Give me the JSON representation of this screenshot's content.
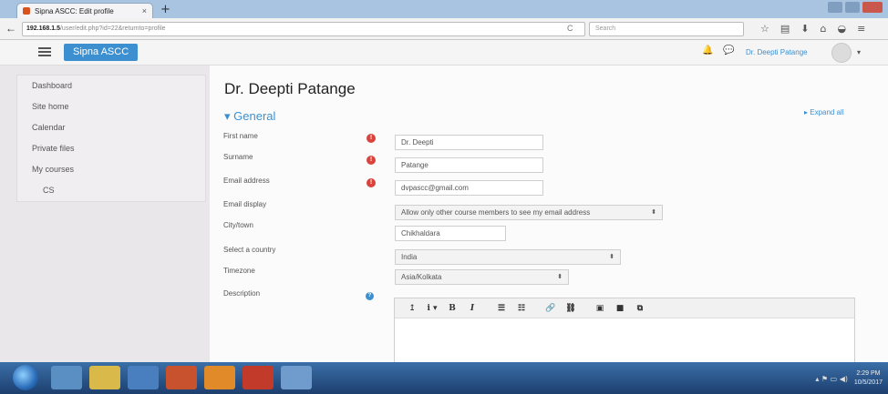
{
  "browser": {
    "tab_title": "Sipna ASCC: Edit profile",
    "tab_close": "×",
    "new_tab": "+",
    "url_host": "192.168.1.5",
    "url_path": "/user/edit.php?id=22&returnto=profile",
    "search_placeholder": "Search",
    "back_glyph": "←",
    "reload_glyph": "C",
    "icons": [
      "star-icon",
      "clipboard-icon",
      "download-icon",
      "home-icon",
      "pocket-icon",
      "menu-icon"
    ]
  },
  "site": {
    "brand": "Sipna ASCC",
    "user_name": "Dr. Deepti Patange"
  },
  "sidebar": {
    "items": [
      {
        "label": "Dashboard"
      },
      {
        "label": "Site home"
      },
      {
        "label": "Calendar"
      },
      {
        "label": "Private files"
      },
      {
        "label": "My courses"
      },
      {
        "label": "CS"
      }
    ]
  },
  "profile": {
    "page_title": "Dr. Deepti Patange",
    "section_title": "General",
    "expand_all": "Expand all"
  },
  "form": {
    "fields": [
      {
        "label": "First name",
        "value": "Dr. Deepti",
        "required": true
      },
      {
        "label": "Surname",
        "value": "Patange",
        "required": true
      },
      {
        "label": "Email address",
        "value": "dvpascc@gmail.com",
        "required": true
      },
      {
        "label": "Email display",
        "value": "Allow only other course members to see my email address"
      },
      {
        "label": "City/town",
        "value": "Chikhaldara"
      },
      {
        "label": "Select a country",
        "value": "India"
      },
      {
        "label": "Timezone",
        "value": "Asia/Kolkata"
      },
      {
        "label": "Description"
      }
    ]
  },
  "editor": {
    "toolbar": [
      "↥",
      "i ▾",
      "B",
      "I",
      "☰",
      "☷",
      "🔗",
      "⛓",
      "▣",
      "■",
      "⧉"
    ]
  },
  "colors": {
    "accent": "#3d90d0",
    "required": "#d9433c"
  },
  "taskbar": {
    "time": "2:29 PM",
    "date": "10/5/2017"
  }
}
